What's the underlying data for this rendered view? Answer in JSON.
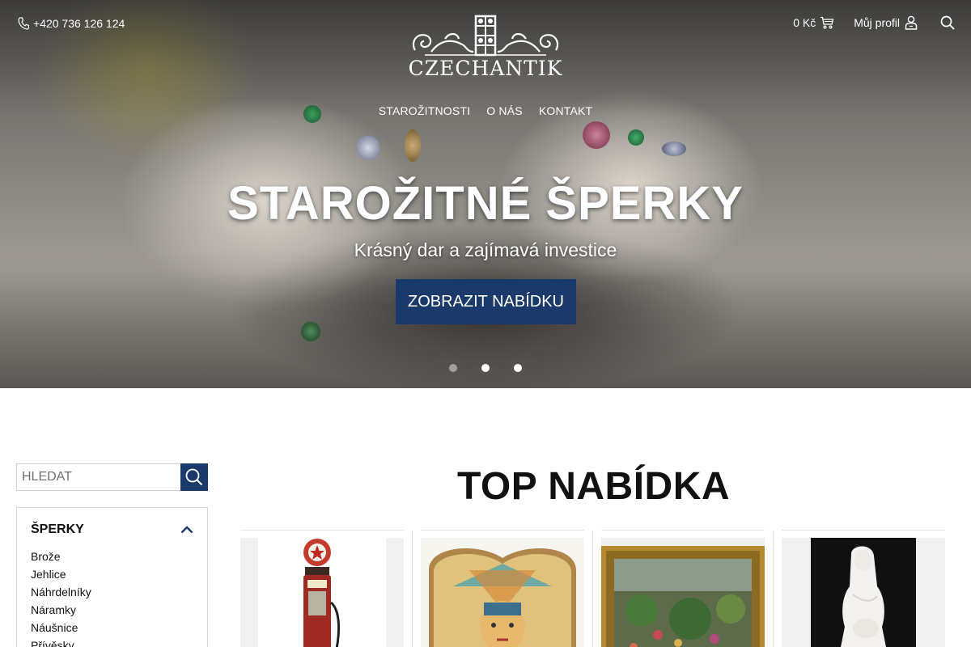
{
  "header": {
    "phone": "+420 736 126 124",
    "logo_text": "CZECHANTIK",
    "cart_total": "0 Kč",
    "profile_label": "Můj profil"
  },
  "nav": {
    "items": [
      "STAROŽITNOSTI",
      "O NÁS",
      "KONTAKT"
    ]
  },
  "hero": {
    "title": "STAROŽITNÉ ŠPERKY",
    "subtitle": "Krásný dar a zajímavá investice",
    "button_label": "ZOBRAZIT NABÍDKU",
    "slides": 3,
    "active_slide": 1
  },
  "sidebar": {
    "search_placeholder": "HLEDAT",
    "category_title": "ŠPERKY",
    "items": [
      "Brože",
      "Jehlice",
      "Náhrdelníky",
      "Náramky",
      "Náušnice",
      "Přívěsky"
    ]
  },
  "top_offer": {
    "title": "TOP NABÍDKA"
  },
  "colors": {
    "accent": "#1a3a6b"
  }
}
